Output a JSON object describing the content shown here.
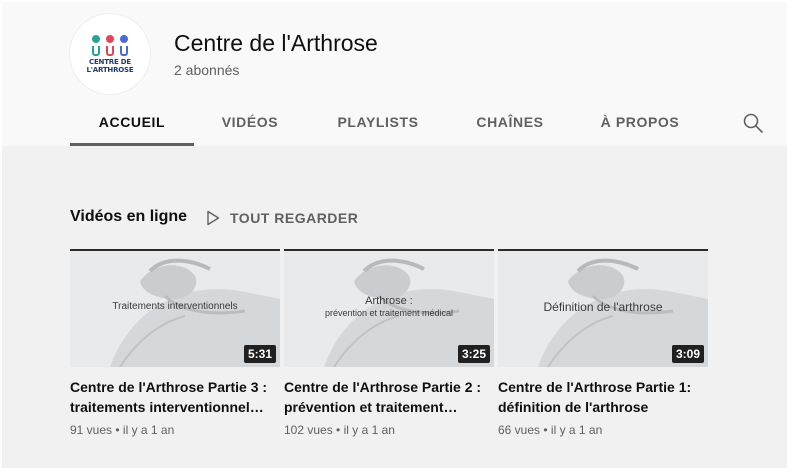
{
  "channel": {
    "name": "Centre de l'Arthrose",
    "subscribers": "2 abonnés",
    "logo_text": [
      "CENTRE DE",
      "L'ARTHROSE"
    ]
  },
  "tabs": [
    {
      "label": "ACCUEIL",
      "active": true
    },
    {
      "label": "VIDÉOS",
      "active": false
    },
    {
      "label": "PLAYLISTS",
      "active": false
    },
    {
      "label": "CHAÎNES",
      "active": false
    },
    {
      "label": "À PROPOS",
      "active": false
    }
  ],
  "shelf": {
    "title": "Vidéos en ligne",
    "play_all": "TOUT REGARDER"
  },
  "videos": [
    {
      "thumb_text": [
        "Traitements interventionnels"
      ],
      "duration": "5:31",
      "title_lines": [
        "Centre de l'Arthrose Partie 3 :",
        "traitements interventionnel…"
      ],
      "views": "91 vues",
      "age": "il y a 1 an"
    },
    {
      "thumb_text": [
        "Arthrose :",
        "prévention et traitement médical"
      ],
      "duration": "3:25",
      "title_lines": [
        "Centre de l'Arthrose Partie 2 :",
        "prévention et traitement…"
      ],
      "views": "102 vues",
      "age": "il y a 1 an"
    },
    {
      "thumb_text": [
        "Définition de l'arthrose"
      ],
      "duration": "3:09",
      "title_lines": [
        "Centre de l'Arthrose Partie 1:",
        "définition de l'arthrose"
      ],
      "views": "66 vues",
      "age": "il y a 1 an"
    }
  ],
  "colors": {
    "page_bg": "#f9f9f9",
    "shelf_bg": "#f1f1f1",
    "active_underline": "#606060",
    "logo_teal": "#2aa198",
    "logo_red": "#e0465b",
    "logo_blue": "#4a6ad1"
  },
  "icons": {
    "search": "search-icon",
    "play_all": "play-outline-icon"
  }
}
